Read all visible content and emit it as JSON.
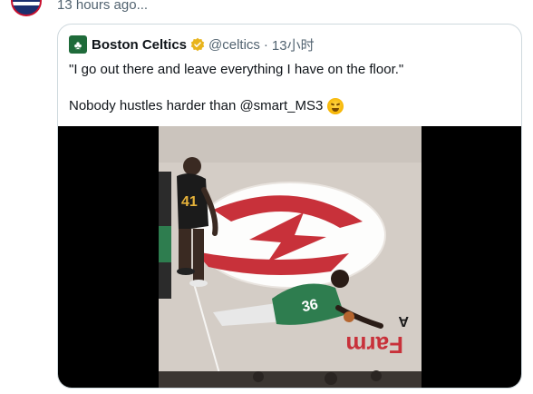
{
  "top_post": {
    "timestamp": "13 hours ago..."
  },
  "quote_tweet": {
    "author_name": "Boston Celtics",
    "handle": "@celtics",
    "separator": "·",
    "time": "13小时",
    "text_line_1": "\"I go out there and leave everything I have on the floor.\"",
    "text_line_2": "Nobody hustles harder than @smart_MS3",
    "emoji": "hot-face-emoji"
  },
  "media": {
    "type": "video",
    "players": [
      {
        "jersey": "41",
        "team_color": "#1b1b1b"
      },
      {
        "jersey": "36",
        "team_color": "#2e7d4f"
      }
    ],
    "floor_text": "Farm",
    "floor_letter": "A",
    "colors": {
      "court_logo_red": "#c8313a",
      "celtics_green": "#2e7d4f",
      "court_floor": "#d6cfc8"
    }
  },
  "colors": {
    "border": "#cfd9de",
    "text": "#0f1419",
    "secondary_text": "#536471",
    "verified_gold": "#e8b41c"
  }
}
